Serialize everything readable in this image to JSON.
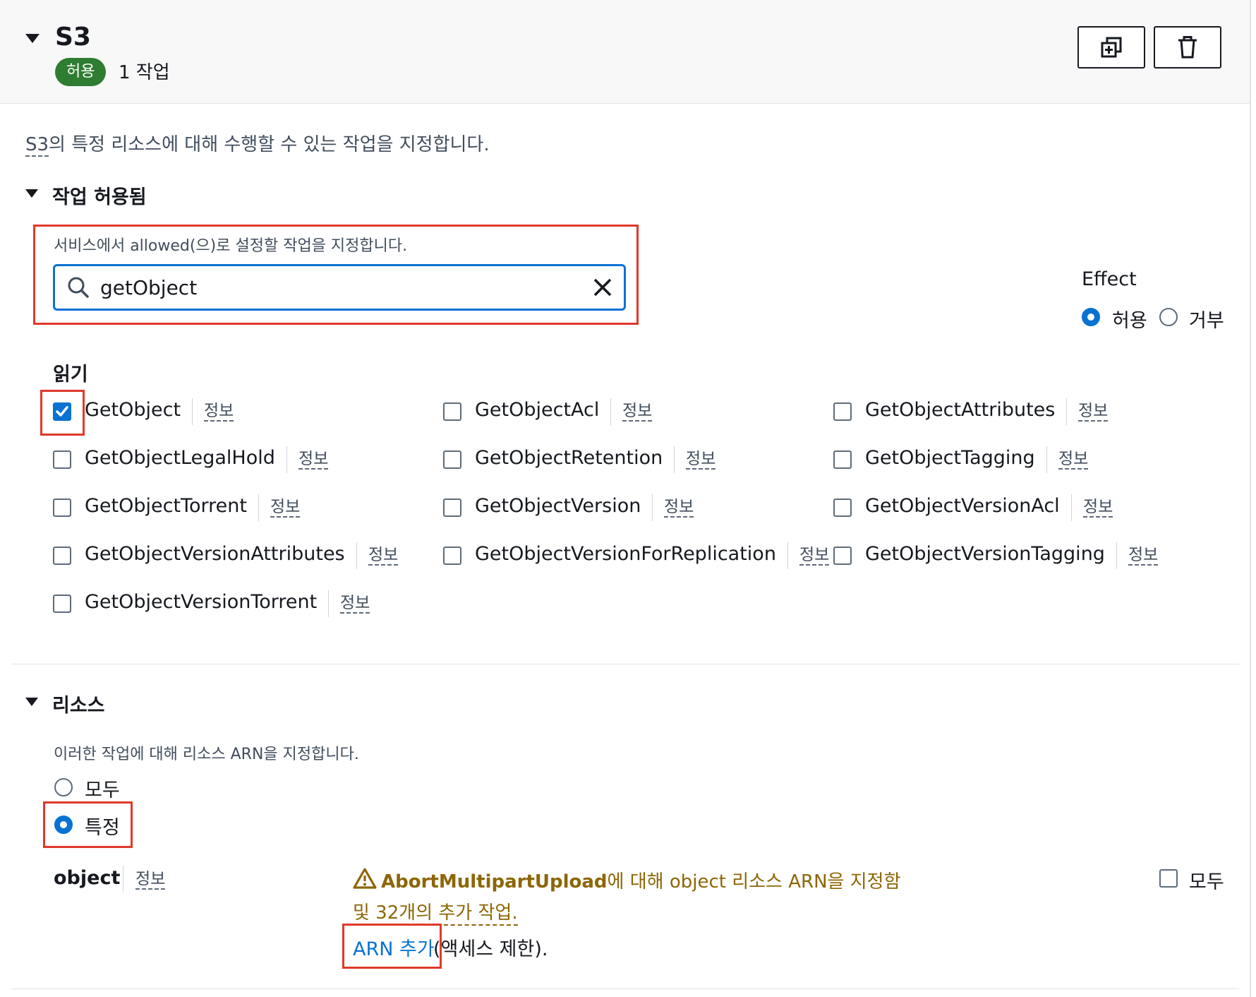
{
  "service": {
    "title": "S3",
    "effect_badge": "허용",
    "action_count": "1 작업",
    "description_prefix": "S3",
    "description_suffix": "의 특정 리소스에 대해 수행할 수 있는 작업을 지정합니다."
  },
  "actions_section": {
    "title": "작업 허용됨",
    "search_hint": "서비스에서 allowed(으)로 설정할 작업을 지정합니다.",
    "search_value": "getObject",
    "effect": {
      "label": "Effect",
      "options": [
        "허용",
        "거부"
      ],
      "selected": "허용"
    },
    "group_title": "읽기",
    "info_label": "정보",
    "items": [
      {
        "label": "GetObject",
        "checked": true
      },
      {
        "label": "GetObjectAcl",
        "checked": false
      },
      {
        "label": "GetObjectAttributes",
        "checked": false
      },
      {
        "label": "GetObjectLegalHold",
        "checked": false
      },
      {
        "label": "GetObjectRetention",
        "checked": false
      },
      {
        "label": "GetObjectTagging",
        "checked": false
      },
      {
        "label": "GetObjectTorrent",
        "checked": false
      },
      {
        "label": "GetObjectVersion",
        "checked": false
      },
      {
        "label": "GetObjectVersionAcl",
        "checked": false
      },
      {
        "label": "GetObjectVersionAttributes",
        "checked": false
      },
      {
        "label": "GetObjectVersionForReplication",
        "checked": false
      },
      {
        "label": "GetObjectVersionTagging",
        "checked": false
      },
      {
        "label": "GetObjectVersionTorrent",
        "checked": false
      }
    ]
  },
  "resources_section": {
    "title": "리소스",
    "description": "이러한 작업에 대해 리소스 ARN을 지정합니다.",
    "options": [
      "모두",
      "특정"
    ],
    "selected": "특정",
    "resource_label": "object",
    "info_label": "정보",
    "warning_bold": "AbortMultipartUpload",
    "warning_rest": "에 대해 object 리소스 ARN을 지정함",
    "warning_line2": "및 32개의 추가 작업.",
    "add_arn_link": "ARN 추가",
    "add_arn_suffix": "(액세스 제한).",
    "any_label": "모두"
  },
  "colors": {
    "accent": "#0972d3",
    "badge": "#2e7d32",
    "highlight": "#e0392b",
    "warning": "#8d6605"
  }
}
